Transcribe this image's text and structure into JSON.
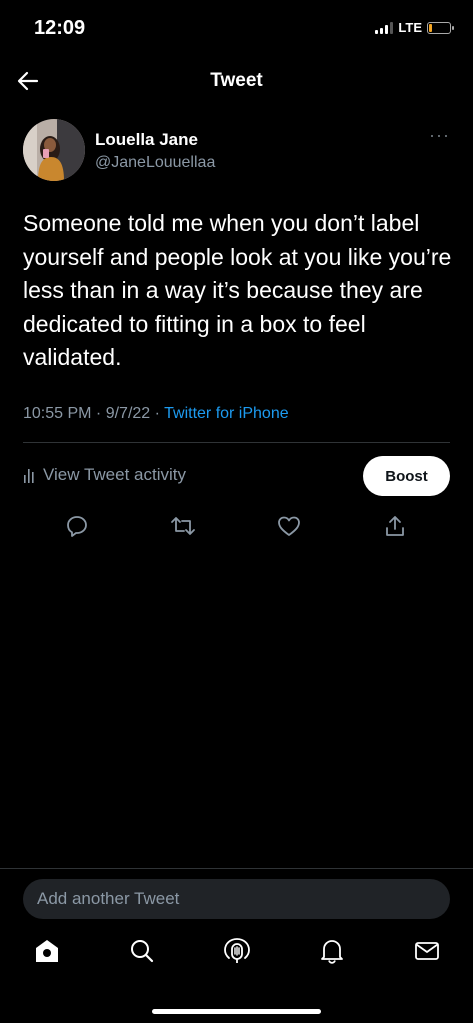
{
  "status": {
    "time": "12:09",
    "network": "LTE"
  },
  "header": {
    "title": "Tweet"
  },
  "tweet": {
    "author_name": "Louella Jane",
    "author_handle": "@JaneLouuellaa",
    "more": "···",
    "text": "Someone told me when you don’t label yourself and people look at you like you’re less than in a way it’s because they are dedicated to fitting in a box to feel validated.",
    "timestamp": "10:55 PM · 9/7/22 · ",
    "source": "Twitter for iPhone"
  },
  "activity": {
    "label": "View Tweet activity",
    "boost_label": "Boost"
  },
  "actions": [
    "reply-icon",
    "retweet-icon",
    "like-icon",
    "share-icon"
  ],
  "compose": {
    "placeholder": "Add another Tweet"
  },
  "tabbar": [
    "home-icon",
    "search-icon",
    "spaces-icon",
    "notifications-icon",
    "messages-icon"
  ],
  "colors": {
    "background": "#000000",
    "accent": "#1d9bf0",
    "muted": "#8b98a5",
    "compose_bg": "#202327"
  }
}
